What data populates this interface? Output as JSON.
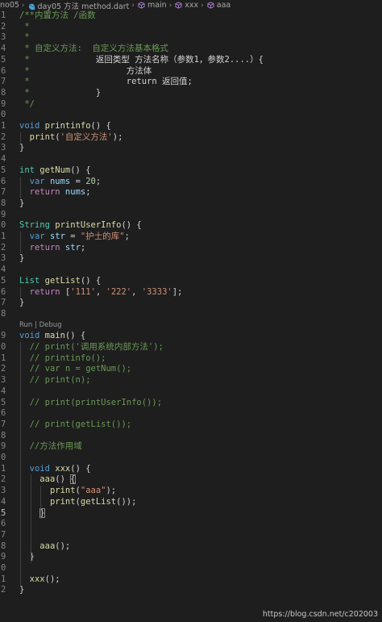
{
  "breadcrumb": {
    "items": [
      {
        "label": "no05",
        "icon": "none"
      },
      {
        "label": "day05 方法 method.dart",
        "icon": "dart-file-icon"
      },
      {
        "label": "main",
        "icon": "cube-icon"
      },
      {
        "label": "xxx",
        "icon": "cube-icon"
      },
      {
        "label": "aaa",
        "icon": "cube-icon"
      }
    ],
    "separator": "›"
  },
  "codelens": "Run | Debug",
  "lines": [
    {
      "n": "1",
      "tokens": [
        [
          "cm",
          "/**内置方法 /函数"
        ]
      ]
    },
    {
      "n": "2",
      "tokens": [
        [
          "cm",
          " *"
        ]
      ]
    },
    {
      "n": "3",
      "tokens": [
        [
          "cm",
          " *"
        ]
      ]
    },
    {
      "n": "4",
      "tokens": [
        [
          "cm",
          " * 自定义方法:  自定义方法基本格式"
        ]
      ]
    },
    {
      "n": "5",
      "tokens": [
        [
          "cm",
          " *"
        ],
        [
          "pn",
          "             返回类型 方法名称（参数1，参数2....）{"
        ]
      ]
    },
    {
      "n": "6",
      "tokens": [
        [
          "cm",
          " *"
        ],
        [
          "pn",
          "                   方法体"
        ]
      ]
    },
    {
      "n": "7",
      "tokens": [
        [
          "cm",
          " *"
        ],
        [
          "pn",
          "                   return 返回值;"
        ]
      ]
    },
    {
      "n": "8",
      "tokens": [
        [
          "cm",
          " *"
        ],
        [
          "pn",
          "             }"
        ]
      ]
    },
    {
      "n": "9",
      "tokens": [
        [
          "cm",
          " */"
        ]
      ]
    },
    {
      "n": "0",
      "tokens": []
    },
    {
      "n": "1",
      "tokens": [
        [
          "kw",
          "void"
        ],
        [
          "pn",
          " "
        ],
        [
          "fn",
          "printinfo"
        ],
        [
          "pn",
          "() {"
        ]
      ]
    },
    {
      "n": "2",
      "tokens": [
        [
          "pn",
          "  "
        ],
        [
          "fn",
          "print"
        ],
        [
          "pn",
          "("
        ],
        [
          "st",
          "'自定义方法'"
        ],
        [
          "pn",
          ");"
        ]
      ]
    },
    {
      "n": "3",
      "tokens": [
        [
          "pn",
          "}"
        ]
      ]
    },
    {
      "n": "4",
      "tokens": []
    },
    {
      "n": "5",
      "tokens": [
        [
          "ty",
          "int"
        ],
        [
          "pn",
          " "
        ],
        [
          "fn",
          "getNum"
        ],
        [
          "pn",
          "() {"
        ]
      ]
    },
    {
      "n": "6",
      "tokens": [
        [
          "pn",
          "  "
        ],
        [
          "kw",
          "var"
        ],
        [
          "pn",
          " "
        ],
        [
          "vr",
          "nums"
        ],
        [
          "pn",
          " = "
        ],
        [
          "nm",
          "20"
        ],
        [
          "pn",
          ";"
        ]
      ]
    },
    {
      "n": "7",
      "tokens": [
        [
          "pn",
          "  "
        ],
        [
          "kc",
          "return"
        ],
        [
          "pn",
          " "
        ],
        [
          "vr",
          "nums"
        ],
        [
          "pn",
          ";"
        ]
      ]
    },
    {
      "n": "8",
      "tokens": [
        [
          "pn",
          "}"
        ]
      ]
    },
    {
      "n": "9",
      "tokens": []
    },
    {
      "n": "0",
      "tokens": [
        [
          "ty",
          "String"
        ],
        [
          "pn",
          " "
        ],
        [
          "fn",
          "printUserInfo"
        ],
        [
          "pn",
          "() {"
        ]
      ]
    },
    {
      "n": "1",
      "tokens": [
        [
          "pn",
          "  "
        ],
        [
          "kw",
          "var"
        ],
        [
          "pn",
          " "
        ],
        [
          "vr",
          "str"
        ],
        [
          "pn",
          " = "
        ],
        [
          "st",
          "\"护士的库\""
        ],
        [
          "pn",
          ";"
        ]
      ]
    },
    {
      "n": "2",
      "tokens": [
        [
          "pn",
          "  "
        ],
        [
          "kc",
          "return"
        ],
        [
          "pn",
          " "
        ],
        [
          "vr",
          "str"
        ],
        [
          "pn",
          ";"
        ]
      ]
    },
    {
      "n": "3",
      "tokens": [
        [
          "pn",
          "}"
        ]
      ]
    },
    {
      "n": "4",
      "tokens": []
    },
    {
      "n": "5",
      "tokens": [
        [
          "ty",
          "List"
        ],
        [
          "pn",
          " "
        ],
        [
          "fn",
          "getList"
        ],
        [
          "pn",
          "() {"
        ]
      ]
    },
    {
      "n": "6",
      "tokens": [
        [
          "pn",
          "  "
        ],
        [
          "kc",
          "return"
        ],
        [
          "pn",
          " ["
        ],
        [
          "st",
          "'111'"
        ],
        [
          "pn",
          ", "
        ],
        [
          "st",
          "'222'"
        ],
        [
          "pn",
          ", "
        ],
        [
          "st",
          "'3333'"
        ],
        [
          "pn",
          "];"
        ]
      ]
    },
    {
      "n": "7",
      "tokens": [
        [
          "pn",
          "}"
        ]
      ]
    },
    {
      "n": "8",
      "tokens": []
    },
    {
      "n": "9",
      "tokens": [
        [
          "kw",
          "void"
        ],
        [
          "pn",
          " "
        ],
        [
          "fn",
          "main"
        ],
        [
          "pn",
          "() {"
        ]
      ]
    },
    {
      "n": "0",
      "tokens": [
        [
          "pn",
          "  "
        ],
        [
          "cm",
          "// print('调用系统内部方法');"
        ]
      ]
    },
    {
      "n": "1",
      "tokens": [
        [
          "pn",
          "  "
        ],
        [
          "cm",
          "// printinfo();"
        ]
      ]
    },
    {
      "n": "2",
      "tokens": [
        [
          "pn",
          "  "
        ],
        [
          "cm",
          "// var n = getNum();"
        ]
      ]
    },
    {
      "n": "3",
      "tokens": [
        [
          "pn",
          "  "
        ],
        [
          "cm",
          "// print(n);"
        ]
      ]
    },
    {
      "n": "4",
      "tokens": []
    },
    {
      "n": "5",
      "tokens": [
        [
          "pn",
          "  "
        ],
        [
          "cm",
          "// print(printUserInfo());"
        ]
      ]
    },
    {
      "n": "6",
      "tokens": []
    },
    {
      "n": "7",
      "tokens": [
        [
          "pn",
          "  "
        ],
        [
          "cm",
          "// print(getList());"
        ]
      ]
    },
    {
      "n": "8",
      "tokens": []
    },
    {
      "n": "9",
      "tokens": [
        [
          "pn",
          "  "
        ],
        [
          "cm",
          "//方法作用域"
        ]
      ]
    },
    {
      "n": "0",
      "tokens": []
    },
    {
      "n": "1",
      "tokens": [
        [
          "pn",
          "  "
        ],
        [
          "kw",
          "void"
        ],
        [
          "pn",
          " "
        ],
        [
          "fn",
          "xxx"
        ],
        [
          "pn",
          "() {"
        ]
      ]
    },
    {
      "n": "2",
      "tokens": [
        [
          "pn",
          "    "
        ],
        [
          "fn",
          "aaa"
        ],
        [
          "pn",
          "() "
        ],
        [
          "pn",
          "{",
          "match"
        ]
      ]
    },
    {
      "n": "3",
      "tokens": [
        [
          "pn",
          "      "
        ],
        [
          "fn",
          "print"
        ],
        [
          "pn",
          "("
        ],
        [
          "st",
          "\"aaa\""
        ],
        [
          "pn",
          ");"
        ]
      ]
    },
    {
      "n": "4",
      "tokens": [
        [
          "pn",
          "      "
        ],
        [
          "fn",
          "print"
        ],
        [
          "pn",
          "("
        ],
        [
          "fn",
          "getList"
        ],
        [
          "pn",
          "());"
        ]
      ]
    },
    {
      "n": "5",
      "active": true,
      "tokens": [
        [
          "pn",
          "    "
        ],
        [
          "pn",
          "}",
          "match"
        ]
      ]
    },
    {
      "n": "6",
      "tokens": []
    },
    {
      "n": "7",
      "tokens": []
    },
    {
      "n": "8",
      "tokens": [
        [
          "pn",
          "    "
        ],
        [
          "fn",
          "aaa"
        ],
        [
          "pn",
          "();"
        ]
      ]
    },
    {
      "n": "9",
      "tokens": [
        [
          "pn",
          "  }"
        ]
      ]
    },
    {
      "n": "0",
      "tokens": []
    },
    {
      "n": "1",
      "tokens": [
        [
          "pn",
          "  "
        ],
        [
          "fn",
          "xxx"
        ],
        [
          "pn",
          "();"
        ]
      ]
    },
    {
      "n": "2",
      "tokens": [
        [
          "pn",
          "}"
        ]
      ]
    }
  ],
  "watermark": "https://blog.csdn.net/c202003",
  "colors": {
    "background": "#1e1e1e",
    "comment": "#6a9955",
    "keyword": "#569cd6",
    "control": "#c586c0",
    "function": "#dcdcaa",
    "type": "#4ec9b0",
    "variable": "#9cdcfe",
    "string": "#ce9178",
    "number": "#b5cea8"
  }
}
